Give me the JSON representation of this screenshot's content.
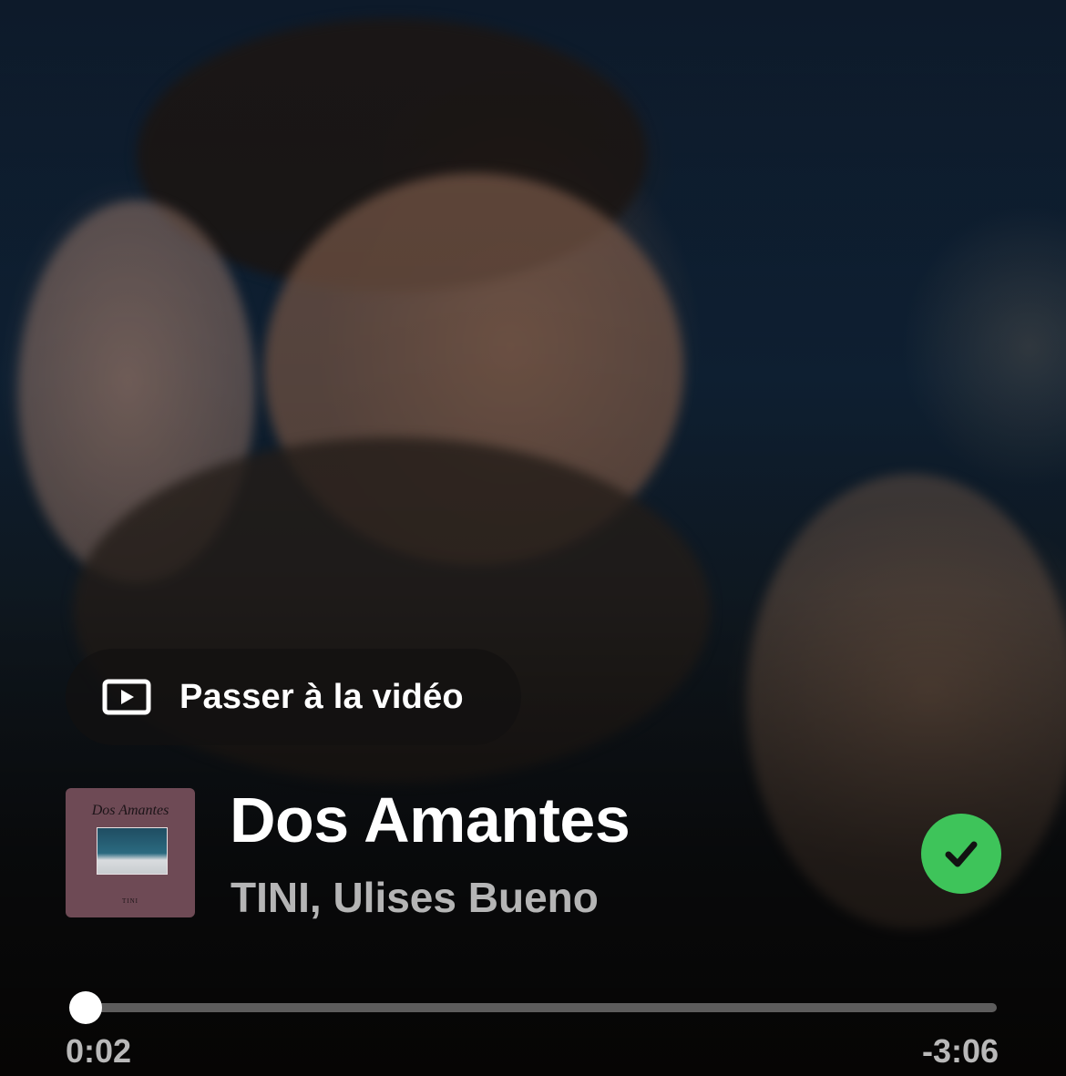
{
  "video_button": {
    "icon": "video-play-icon",
    "label": "Passer à la vidéo"
  },
  "track": {
    "title": "Dos Amantes",
    "artists": "TINI, Ulises Bueno",
    "saved": true,
    "saved_icon": "check-icon",
    "accent_color": "#3ec45a"
  },
  "album_cover": {
    "title": "Dos Amantes",
    "artist": "TINI",
    "background_color": "#6e4a55"
  },
  "playback": {
    "elapsed": "0:02",
    "remaining": "-3:06",
    "progress_fraction": 0.016
  }
}
